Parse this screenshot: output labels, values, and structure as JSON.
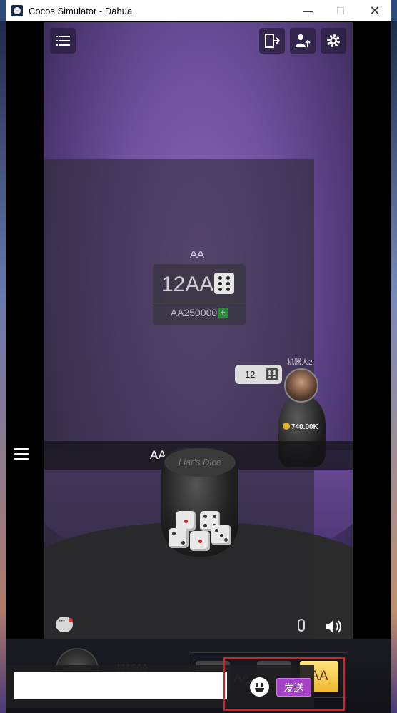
{
  "window": {
    "title": "Cocos Simulator - Dahua",
    "minimize": "—",
    "maximize": "☐",
    "close": "✕"
  },
  "toolbar": {
    "menu_icon": "list-icon",
    "exit_icon": "exit-door-icon",
    "user_icon": "user-upload-icon",
    "settings_icon": "gear-icon"
  },
  "bid_panel": {
    "label": "AA",
    "current_bid": "12AA",
    "pot": "AA250000",
    "plus": "+"
  },
  "opponent": {
    "name": "机器人2",
    "bid": "12",
    "chips": "740.00K"
  },
  "banner": {
    "text": "AA"
  },
  "cup": {
    "logo": "Liar's Dice"
  },
  "bottom": {
    "player_id": "111809",
    "action_label": "AA",
    "gold_button": "AA"
  },
  "chat": {
    "input_value": "",
    "input_placeholder": "",
    "send_label": "发送"
  },
  "colors": {
    "send_button": "#a642c8",
    "gold_button": "#f0b832",
    "highlight": "#e02020"
  }
}
